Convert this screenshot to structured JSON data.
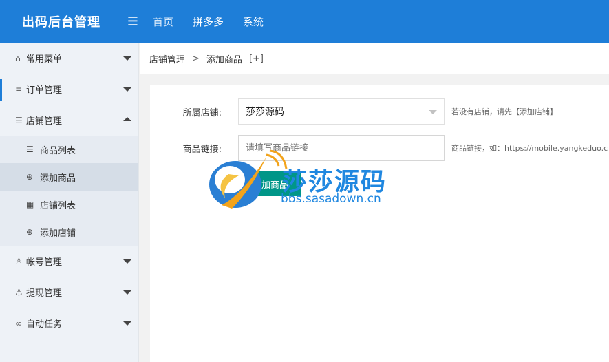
{
  "header": {
    "brand": "出码后台管理",
    "fold_icon": "indent-icon",
    "nav": [
      "首页",
      "拼多多",
      "系统"
    ]
  },
  "sidebar": {
    "items": [
      {
        "label": "常用菜单",
        "icon": "home-icon"
      },
      {
        "label": "订单管理",
        "icon": "database-icon"
      },
      {
        "label": "店铺管理",
        "icon": "list-icon"
      },
      {
        "label": "帐号管理",
        "icon": "user-icon"
      },
      {
        "label": "提现管理",
        "icon": "anchor-icon"
      },
      {
        "label": "自动任务",
        "icon": "link-icon"
      }
    ],
    "sub_items": [
      {
        "label": "商品列表",
        "icon": "list-icon"
      },
      {
        "label": "添加商品",
        "icon": "plus-circle-icon"
      },
      {
        "label": "店铺列表",
        "icon": "grid-icon"
      },
      {
        "label": "添加店铺",
        "icon": "plus-circle-icon"
      }
    ]
  },
  "breadcrumb": {
    "parent": "店铺管理",
    "separator": ">",
    "current": "添加商品",
    "plus": "[+]"
  },
  "form": {
    "shop_label": "所属店铺:",
    "shop_value": "莎莎源码",
    "shop_hint": "若没有店铺，请先【添加店铺】",
    "link_label": "商品链接:",
    "link_placeholder": "请填写商品链接",
    "link_hint": "商品链接，如：https://mobile.yangkeduo.c",
    "submit_label": "添加商品"
  },
  "watermark": {
    "title": "莎莎源码",
    "url": "bbs.sasadown.cn"
  },
  "colors": {
    "header": "#1e7ed8",
    "button": "#009688",
    "sidebar": "#eef2f7"
  }
}
